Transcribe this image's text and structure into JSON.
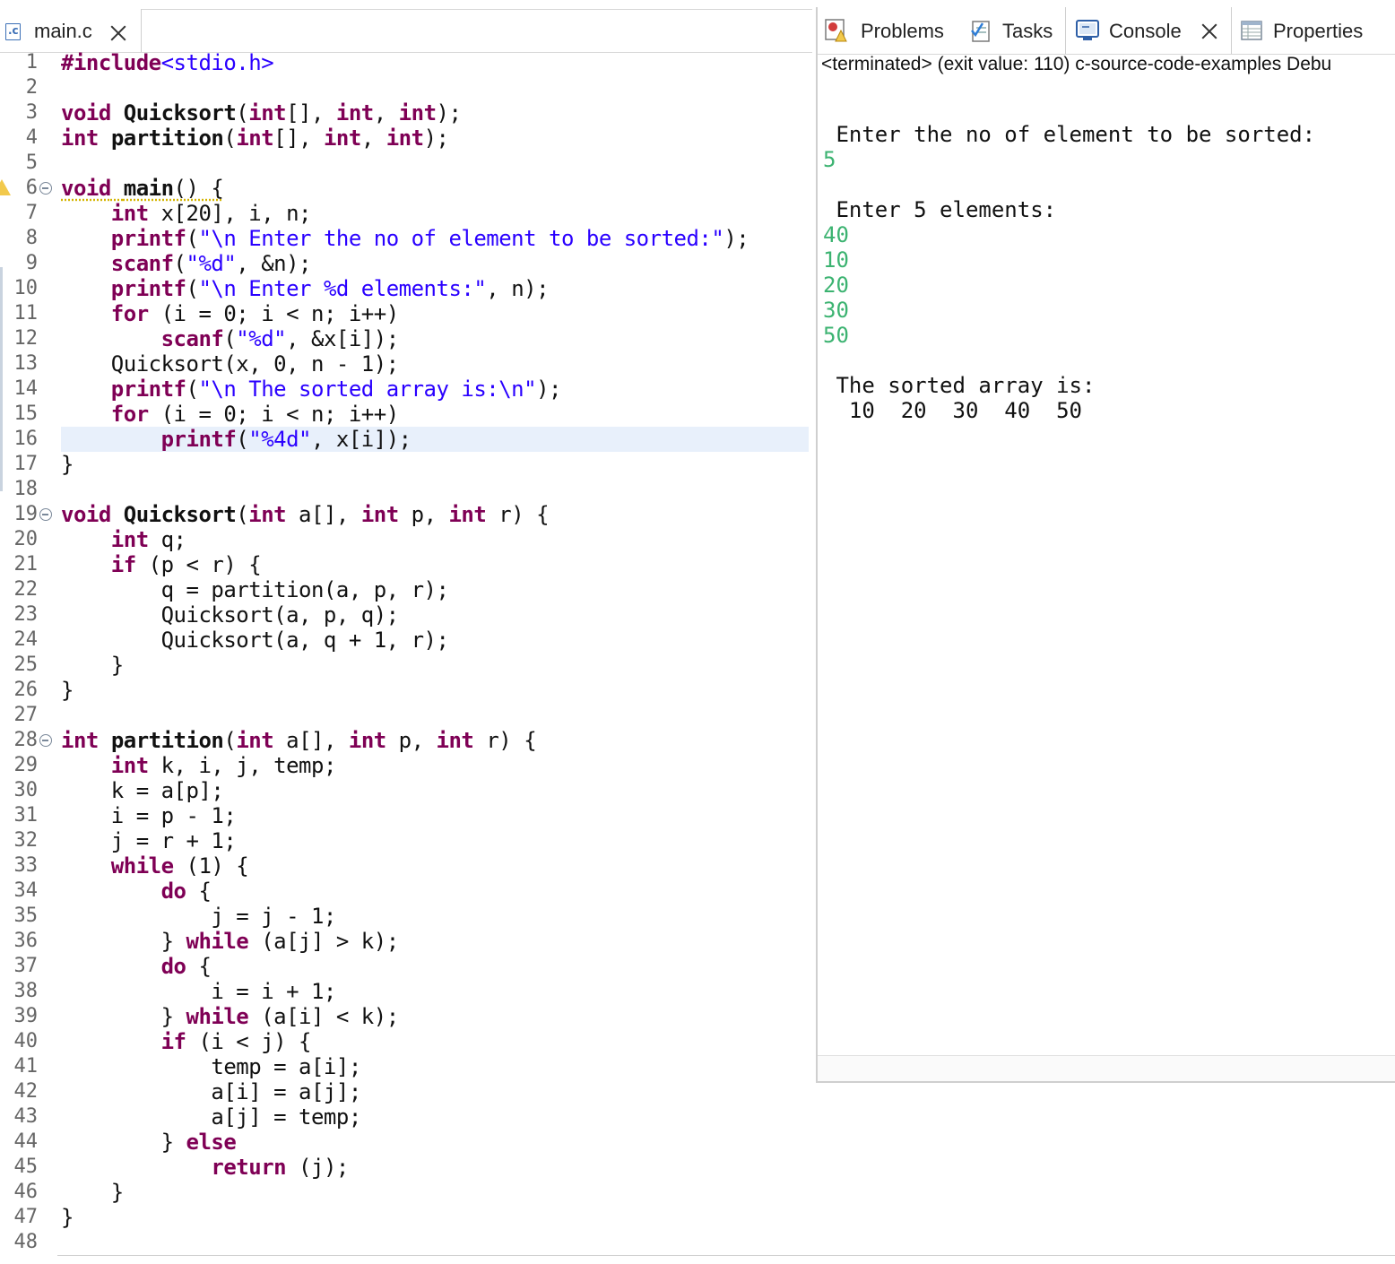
{
  "editor": {
    "tab_label": "main.c",
    "lines": [
      {
        "n": "1",
        "html": "<span class='kw'>#include</span><span class='st'>&lt;stdio.h&gt;</span>"
      },
      {
        "n": "2",
        "html": ""
      },
      {
        "n": "3",
        "html": "<span class='kw'>void</span> <span class='fn'>Quicksort</span>(<span class='kw'>int</span>[], <span class='kw'>int</span>, <span class='kw'>int</span>);"
      },
      {
        "n": "4",
        "html": "<span class='kw'>int</span> <span class='fn'>partition</span>(<span class='kw'>int</span>[], <span class='kw'>int</span>, <span class='kw'>int</span>);"
      },
      {
        "n": "5",
        "html": ""
      },
      {
        "n": "6",
        "html": "<span class='warnline'><span class='kw'>void</span> <span class='fn'>main</span>() {</span>",
        "fold": true,
        "warn": true
      },
      {
        "n": "7",
        "html": "    <span class='kw'>int</span> x[20], i, n;"
      },
      {
        "n": "8",
        "html": "    <span class='kw'>printf</span>(<span class='st'>\"\\n Enter the no of element to be sorted:\"</span>);"
      },
      {
        "n": "9",
        "html": "    <span class='kw'>scanf</span>(<span class='st'>\"%d\"</span>, &amp;n);"
      },
      {
        "n": "10",
        "html": "    <span class='kw'>printf</span>(<span class='st'>\"\\n Enter %d elements:\"</span>, n);"
      },
      {
        "n": "11",
        "html": "    <span class='kw'>for</span> (i = 0; i &lt; n; i++)"
      },
      {
        "n": "12",
        "html": "        <span class='kw'>scanf</span>(<span class='st'>\"%d\"</span>, &amp;x[i]);"
      },
      {
        "n": "13",
        "html": "    Quicksort(x, 0, n - 1);"
      },
      {
        "n": "14",
        "html": "    <span class='kw'>printf</span>(<span class='st'>\"\\n The sorted array is:\\n\"</span>);"
      },
      {
        "n": "15",
        "html": "    <span class='kw'>for</span> (i = 0; i &lt; n; i++)"
      },
      {
        "n": "16",
        "html": "        <span class='kw'>printf</span>(<span class='st'>\"%4d\"</span>, x[i]);",
        "hl": true
      },
      {
        "n": "17",
        "html": "}"
      },
      {
        "n": "18",
        "html": ""
      },
      {
        "n": "19",
        "html": "<span class='kw'>void</span> <span class='fn'>Quicksort</span>(<span class='kw'>int</span> a[], <span class='kw'>int</span> p, <span class='kw'>int</span> r) {",
        "fold": true
      },
      {
        "n": "20",
        "html": "    <span class='kw'>int</span> q;"
      },
      {
        "n": "21",
        "html": "    <span class='kw'>if</span> (p &lt; r) {"
      },
      {
        "n": "22",
        "html": "        q = partition(a, p, r);"
      },
      {
        "n": "23",
        "html": "        Quicksort(a, p, q);"
      },
      {
        "n": "24",
        "html": "        Quicksort(a, q + 1, r);"
      },
      {
        "n": "25",
        "html": "    }"
      },
      {
        "n": "26",
        "html": "}"
      },
      {
        "n": "27",
        "html": ""
      },
      {
        "n": "28",
        "html": "<span class='kw'>int</span> <span class='fn'>partition</span>(<span class='kw'>int</span> a[], <span class='kw'>int</span> p, <span class='kw'>int</span> r) {",
        "fold": true
      },
      {
        "n": "29",
        "html": "    <span class='kw'>int</span> k, i, j, temp;"
      },
      {
        "n": "30",
        "html": "    k = a[p];"
      },
      {
        "n": "31",
        "html": "    i = p - 1;"
      },
      {
        "n": "32",
        "html": "    j = r + 1;"
      },
      {
        "n": "33",
        "html": "    <span class='kw'>while</span> (1) {"
      },
      {
        "n": "34",
        "html": "        <span class='kw'>do</span> {"
      },
      {
        "n": "35",
        "html": "            j = j - 1;"
      },
      {
        "n": "36",
        "html": "        } <span class='kw'>while</span> (a[j] &gt; k);"
      },
      {
        "n": "37",
        "html": "        <span class='kw'>do</span> {"
      },
      {
        "n": "38",
        "html": "            i = i + 1;"
      },
      {
        "n": "39",
        "html": "        } <span class='kw'>while</span> (a[i] &lt; k);"
      },
      {
        "n": "40",
        "html": "        <span class='kw'>if</span> (i &lt; j) {"
      },
      {
        "n": "41",
        "html": "            temp = a[i];"
      },
      {
        "n": "42",
        "html": "            a[i] = a[j];"
      },
      {
        "n": "43",
        "html": "            a[j] = temp;"
      },
      {
        "n": "44",
        "html": "        } <span class='kw'>else</span>"
      },
      {
        "n": "45",
        "html": "            <span class='kw'>return</span> (j);"
      },
      {
        "n": "46",
        "html": "    }"
      },
      {
        "n": "47",
        "html": "}"
      },
      {
        "n": "48",
        "html": ""
      }
    ]
  },
  "panel": {
    "tabs": [
      {
        "label": "Problems",
        "icon": "problems-icon"
      },
      {
        "label": "Tasks",
        "icon": "tasks-icon"
      },
      {
        "label": "Console",
        "icon": "console-icon",
        "active": true
      },
      {
        "label": "Properties",
        "icon": "properties-icon"
      }
    ],
    "status": "<terminated> (exit value: 110) c-source-code-examples Debu",
    "console_lines": [
      {
        "text": "",
        "kind": "out"
      },
      {
        "text": " Enter the no of element to be sorted:",
        "kind": "out"
      },
      {
        "text": "5",
        "kind": "in"
      },
      {
        "text": "",
        "kind": "out"
      },
      {
        "text": " Enter 5 elements:",
        "kind": "out"
      },
      {
        "text": "40",
        "kind": "in"
      },
      {
        "text": "10",
        "kind": "in"
      },
      {
        "text": "20",
        "kind": "in"
      },
      {
        "text": "30",
        "kind": "in"
      },
      {
        "text": "50",
        "kind": "in"
      },
      {
        "text": "",
        "kind": "out"
      },
      {
        "text": " The sorted array is:",
        "kind": "out"
      },
      {
        "text": "  10  20  30  40  50",
        "kind": "out"
      }
    ]
  },
  "colors": {
    "keyword": "#7f0055",
    "string": "#2a00ff",
    "console_input": "#3cb371",
    "highlight": "#e8f0fb"
  }
}
